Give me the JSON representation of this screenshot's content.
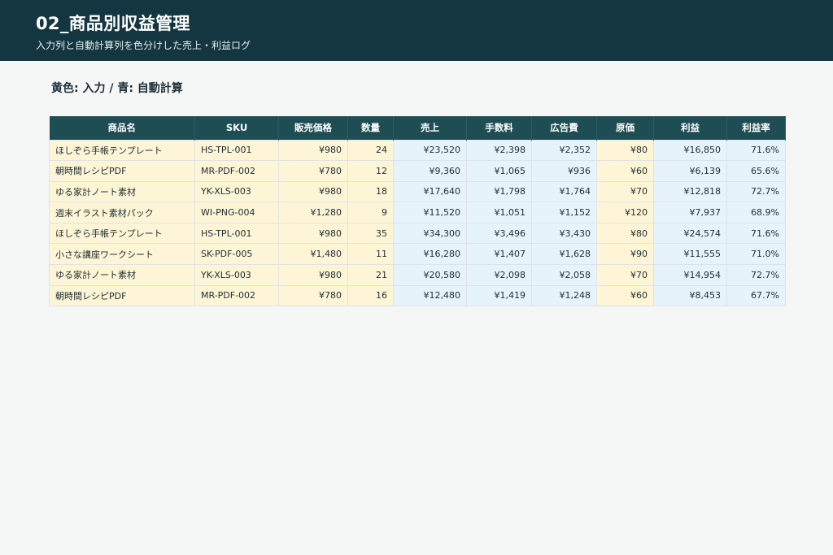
{
  "header": {
    "title": "02_商品別収益管理",
    "subtitle": "入力列と自動計算列を色分けした売上・利益ログ"
  },
  "legend": "黄色: 入力 / 青: 自動計算",
  "colors": {
    "header_bg": "#143640",
    "table_header_bg": "#1f4d54",
    "input_cell": "#fdf5d6",
    "calc_cell": "#e6f3fb"
  },
  "table": {
    "columns": [
      "商品名",
      "SKU",
      "販売価格",
      "数量",
      "売上",
      "手数料",
      "広告費",
      "原価",
      "利益",
      "利益率"
    ],
    "column_types": [
      "in",
      "in",
      "in",
      "in",
      "calc",
      "calc",
      "calc",
      "in",
      "calc",
      "calc"
    ],
    "rows": [
      [
        "ほしぞら手帳テンプレート",
        "HS-TPL-001",
        "¥980",
        "24",
        "¥23,520",
        "¥2,398",
        "¥2,352",
        "¥80",
        "¥16,850",
        "71.6%"
      ],
      [
        "朝時間レシピPDF",
        "MR-PDF-002",
        "¥780",
        "12",
        "¥9,360",
        "¥1,065",
        "¥936",
        "¥60",
        "¥6,139",
        "65.6%"
      ],
      [
        "ゆる家計ノート素材",
        "YK-XLS-003",
        "¥980",
        "18",
        "¥17,640",
        "¥1,798",
        "¥1,764",
        "¥70",
        "¥12,818",
        "72.7%"
      ],
      [
        "週末イラスト素材パック",
        "WI-PNG-004",
        "¥1,280",
        "9",
        "¥11,520",
        "¥1,051",
        "¥1,152",
        "¥120",
        "¥7,937",
        "68.9%"
      ],
      [
        "ほしぞら手帳テンプレート",
        "HS-TPL-001",
        "¥980",
        "35",
        "¥34,300",
        "¥3,496",
        "¥3,430",
        "¥80",
        "¥24,574",
        "71.6%"
      ],
      [
        "小さな講座ワークシート",
        "SK-PDF-005",
        "¥1,480",
        "11",
        "¥16,280",
        "¥1,407",
        "¥1,628",
        "¥90",
        "¥11,555",
        "71.0%"
      ],
      [
        "ゆる家計ノート素材",
        "YK-XLS-003",
        "¥980",
        "21",
        "¥20,580",
        "¥2,098",
        "¥2,058",
        "¥70",
        "¥14,954",
        "72.7%"
      ],
      [
        "朝時間レシピPDF",
        "MR-PDF-002",
        "¥780",
        "16",
        "¥12,480",
        "¥1,419",
        "¥1,248",
        "¥60",
        "¥8,453",
        "67.7%"
      ]
    ]
  }
}
